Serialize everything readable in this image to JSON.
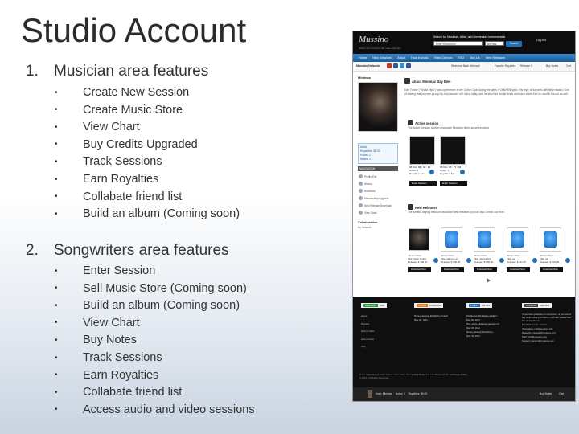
{
  "slide": {
    "title": "Studio Account",
    "section1": {
      "number": "1.",
      "heading": "Musician area features",
      "bullets": [
        "Create New Session",
        "Create Music Store",
        "View Chart",
        "Buy Credits Upgraded",
        "Track Sessions",
        "Earn Royalties",
        "Collabate friend list",
        "Build an album (Coming soon)"
      ]
    },
    "section2": {
      "number": "2.",
      "heading": "Songwriters area features",
      "bullets": [
        "Enter Session",
        "Sell Music Store (Coming soon)",
        "Build an album (Coming soon)",
        "View Chart",
        "Buy Notes",
        "Track Sessions",
        "Earn Royalties",
        "Collabate friend list",
        "Access audio and video sessions"
      ]
    },
    "bullet_glyph": "•"
  },
  "screenshot": {
    "logo": "Mussino",
    "logo_sub": "Where the musician can make and gain",
    "search_label": "Search for Musician, Artist, and Unreleased instrumentals",
    "search_placeholder": "Enter Keyword(s)",
    "search_select": "All Files",
    "search_button": "Search",
    "login": "Log out",
    "nav": [
      "Home",
      "New Sessions",
      "About",
      "How it works",
      "Video Demos",
      "FAQ",
      "Join Us",
      "New Releases"
    ],
    "network": "Mussino Network",
    "welcome": "Welcome Back Minimax!",
    "links": [
      "Favorite Royalties",
      "Release 1",
      "Buy Notes",
      "Cart"
    ],
    "username": "Minimax",
    "stats": {
      "role": "Artist",
      "royalties": "Royalties: $0.00",
      "posts": "Posts: 2",
      "notes": "Notes: 1"
    },
    "navigation_heading": "NAVIGATION",
    "nav_items": [
      "Profile Edit",
      "History",
      "Notebook",
      "Membership Upgrade",
      "New Release Download",
      "View Chart"
    ],
    "collab_heading": "Collaboration",
    "collab_text": "No Network",
    "about_heading": "About Minimax Bay Ewe",
    "about_text": "Earl Tucker (\"Snake Hips\") was a performer at the Cotton Club during the days of Duke Ellington. His style of dance is definitely related. One of waxing that you see young hip-hop dancers still doing today, and he also had similar floats and back slides that he used in his act as well.",
    "active_heading": "Active session",
    "active_sub": "The Active Session section showcase Musician latest active sessions.",
    "sessions": [
      {
        "date": "06 Oct. 08 : 33 : 23",
        "notes": "Notes: 1",
        "royalties": "Royalties: $ 0",
        "button": "Enter Session"
      },
      {
        "date": "06 Oct. 08 : 27 : 33",
        "notes": "Notes: 1",
        "royalties": "Royalties: $ 0",
        "button": "Enter Session"
      }
    ],
    "releases_heading": "New Releases",
    "releases_sub": "The section display Random Musician New releases you can also Check out Here.",
    "releases": [
      {
        "artist": "James Peter",
        "title": "Title: Noch Reloa",
        "release": "Release: $ 300.00",
        "button": "Download Now"
      },
      {
        "artist": "James Peter",
        "title": "Title: ballo ps gc",
        "release": "Release: $ 300.00",
        "button": "Download Now"
      },
      {
        "artist": "James Peter",
        "title": "Title: what is the",
        "release": "Release: $ 200.00",
        "button": "Download Now"
      },
      {
        "artist": "James Peter",
        "title": "Title: a2",
        "release": "Release: $ 111.00",
        "button": "Download Now"
      },
      {
        "artist": "James Peter",
        "title": "Title: a2",
        "release": "Release: $ 222.00",
        "button": "Download Now"
      }
    ],
    "footer": {
      "tags": [
        "REMARKS",
        "LATEST",
        "LATEST",
        "SUPPORT"
      ],
      "tag_words": [
        "LINK",
        "MUSICIAN",
        "ARTIST",
        "CENTER"
      ],
      "links": [
        "Home",
        "Register",
        "How to Video",
        "How it works",
        "FAQ"
      ],
      "col2": [
        "Money desktop Publishing Ireland",
        "May 30, 2012"
      ],
      "col3": [
        "Distribution Worldwide Addition",
        "May 30, 2012",
        "Mac notice call spam question at",
        "May 30, 2012",
        "Money desktop Publishing",
        "May 30, 2012"
      ],
      "col4": [
        "If you have questions or comments, or you would like to find what you need on this site, please feel free to contact us.",
        "Email Addresses website",
        "Information: info@mussino.info",
        "Networks: network@mussino.com",
        "Staff: staff@mussino.org",
        "Support: support@mussino.com"
      ],
      "bottom_links": "Home  About  How it works  How to Video  Video Demos  FAQ  Terms and Conditions  Contact Us  Privacy Policy",
      "copyright": "© 2012 - All Rights Reserved",
      "user_bar": "User: Minimax    Notes: 1    Royalties: $0.00",
      "buy_notes": "Buy Notes",
      "cart": "Cart"
    }
  }
}
